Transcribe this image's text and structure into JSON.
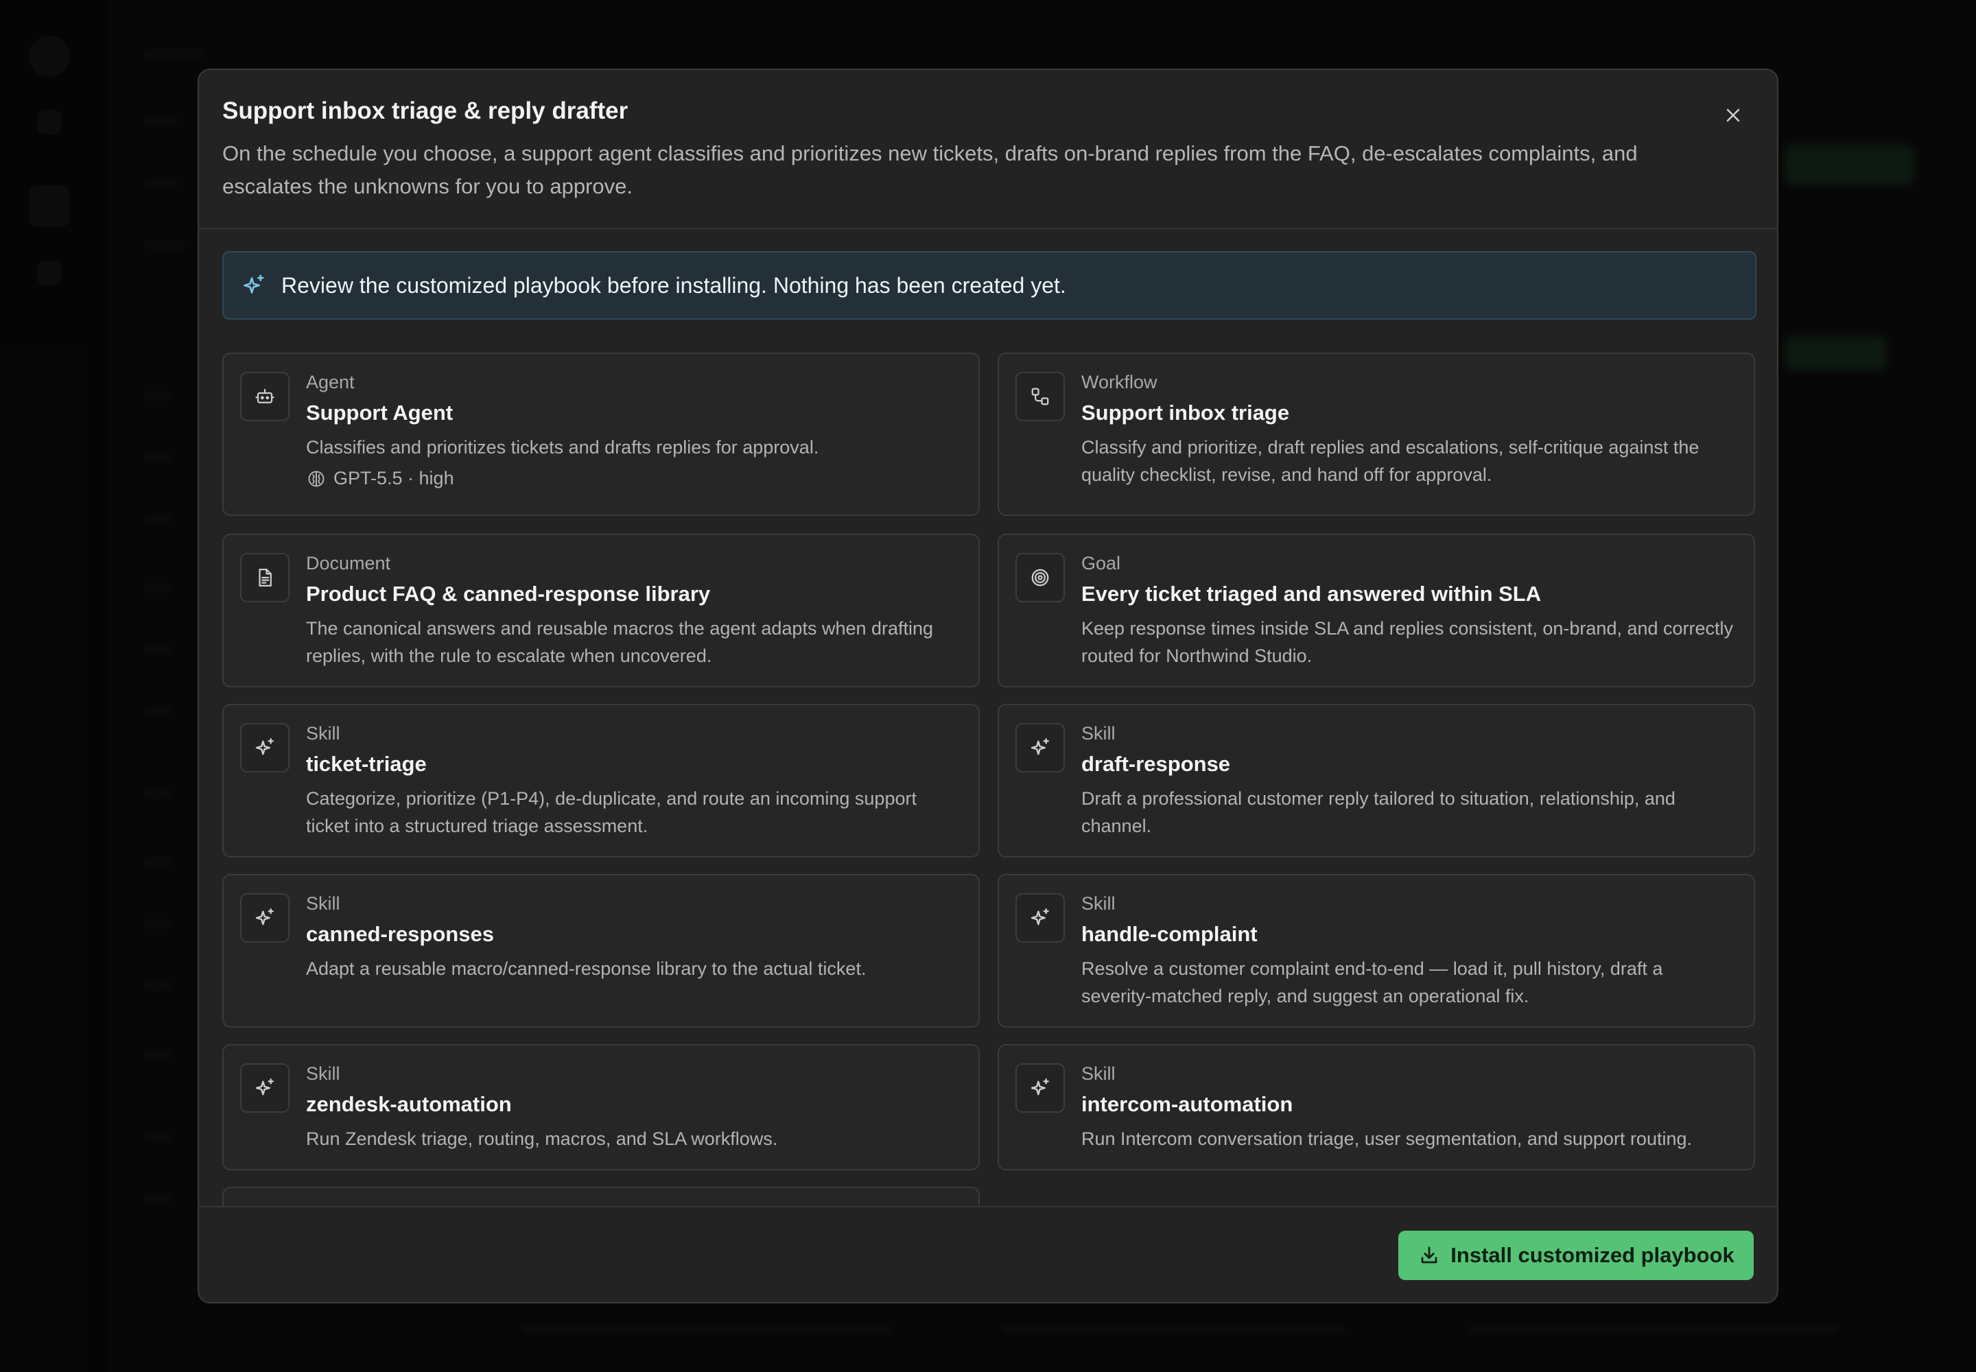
{
  "modal": {
    "title": "Support inbox triage & reply drafter",
    "description": "On the schedule you choose, a support agent classifies and prioritizes new tickets, drafts on-brand replies from the FAQ, de-escalates complaints, and escalates the unknowns for you to approve.",
    "close_icon": "close-icon"
  },
  "notice": {
    "icon": "sparkle-icon",
    "text": "Review the customized playbook before installing. Nothing has been created yet."
  },
  "cards": [
    {
      "type": "Agent",
      "title": "Support Agent",
      "description": "Classifies and prioritizes tickets and drafts replies for approval.",
      "icon": "bot-icon",
      "meta": "GPT-5.5 · high",
      "meta_icon": "brain-icon"
    },
    {
      "type": "Workflow",
      "title": "Support inbox triage",
      "description": "Classify and prioritize, draft replies and escalations, self-critique against the quality checklist, revise, and hand off for approval.",
      "icon": "workflow-icon"
    },
    {
      "type": "Document",
      "title": "Product FAQ & canned-response library",
      "description": "The canonical answers and reusable macros the agent adapts when drafting replies, with the rule to escalate when uncovered.",
      "icon": "document-icon"
    },
    {
      "type": "Goal",
      "title": "Every ticket triaged and answered within SLA",
      "description": "Keep response times inside SLA and replies consistent, on-brand, and correctly routed for Northwind Studio.",
      "icon": "target-icon"
    },
    {
      "type": "Skill",
      "title": "ticket-triage",
      "description": "Categorize, prioritize (P1-P4), de-duplicate, and route an incoming support ticket into a structured triage assessment.",
      "icon": "sparkle-icon"
    },
    {
      "type": "Skill",
      "title": "draft-response",
      "description": "Draft a professional customer reply tailored to situation, relationship, and channel.",
      "icon": "sparkle-icon"
    },
    {
      "type": "Skill",
      "title": "canned-responses",
      "description": "Adapt a reusable macro/canned-response library to the actual ticket.",
      "icon": "sparkle-icon"
    },
    {
      "type": "Skill",
      "title": "handle-complaint",
      "description": "Resolve a customer complaint end-to-end — load it, pull history, draft a severity-matched reply, and suggest an operational fix.",
      "icon": "sparkle-icon"
    },
    {
      "type": "Skill",
      "title": "zendesk-automation",
      "description": "Run Zendesk triage, routing, macros, and SLA workflows.",
      "icon": "sparkle-icon"
    },
    {
      "type": "Skill",
      "title": "intercom-automation",
      "description": "Run Intercom conversation triage, user segmentation, and support routing.",
      "icon": "sparkle-icon"
    }
  ],
  "footer": {
    "install_label": "Install customized playbook",
    "install_icon": "download-icon"
  },
  "colors": {
    "accent": "#56c275",
    "notice_bg": "#233038",
    "notice_icon": "#7cc4e8",
    "modal_bg": "#232323"
  }
}
